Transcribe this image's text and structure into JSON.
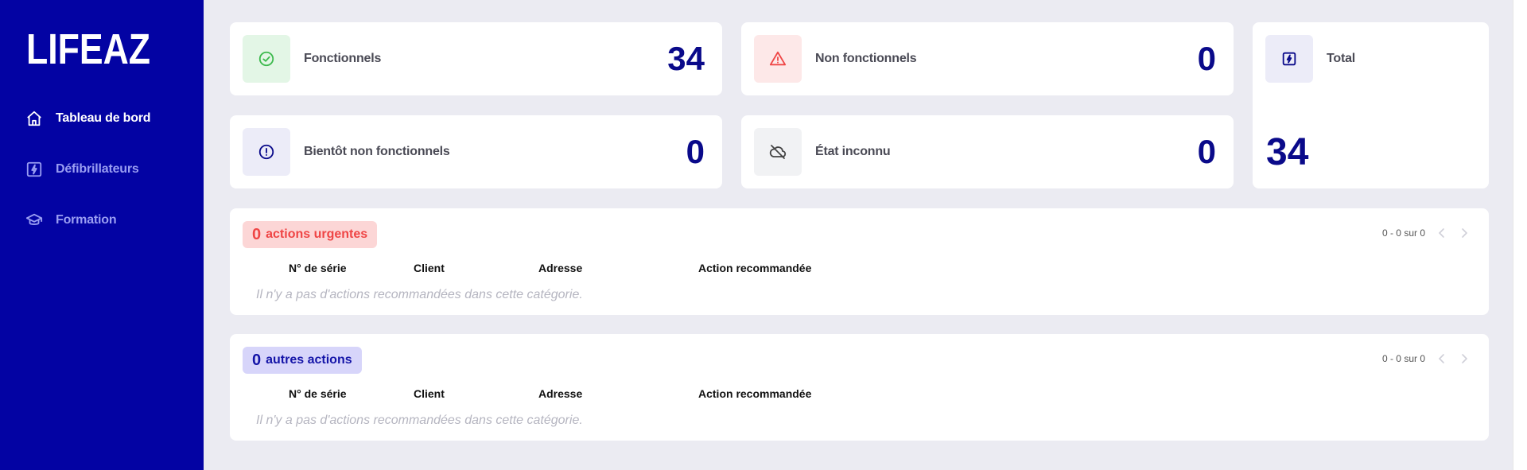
{
  "brand": {
    "name": "LIFEAZ"
  },
  "sidebar": {
    "items": [
      {
        "label": "Tableau de bord",
        "icon": "home-icon",
        "active": true
      },
      {
        "label": "Défibrillateurs",
        "icon": "lightning-icon",
        "active": false
      },
      {
        "label": "Formation",
        "icon": "graduation-cap-icon",
        "active": false
      }
    ]
  },
  "stats": {
    "functional": {
      "label": "Fonctionnels",
      "value": "34",
      "icon": "check-circle-icon"
    },
    "non_functional": {
      "label": "Non fonctionnels",
      "value": "0",
      "icon": "warning-triangle-icon"
    },
    "total": {
      "label": "Total",
      "value": "34",
      "icon": "lightning-icon"
    },
    "soon_non_functional": {
      "label": "Bientôt non fonctionnels",
      "value": "0",
      "icon": "exclamation-circle-icon"
    },
    "unknown": {
      "label": "État inconnu",
      "value": "0",
      "icon": "cloud-off-icon"
    }
  },
  "urgent": {
    "count": "0",
    "label": "actions urgentes",
    "pagination": "0 - 0 sur 0",
    "columns": [
      "N° de série",
      "Client",
      "Adresse",
      "Action recommandée"
    ],
    "empty_text": "Il n'y a pas d'actions recommandées dans cette catégorie."
  },
  "other": {
    "count": "0",
    "label": "autres actions",
    "pagination": "0 - 0 sur 0",
    "columns": [
      "N° de série",
      "Client",
      "Adresse",
      "Action recommandée"
    ],
    "empty_text": "Il n'y a pas d'actions recommandées dans cette catégorie."
  },
  "colors": {
    "sidebar": "#0303a3",
    "stat_value": "#0a0a8a",
    "urgent": "#ef4545",
    "other": "#1414a8",
    "success": "#3dba4e",
    "background": "#ebebf2"
  }
}
